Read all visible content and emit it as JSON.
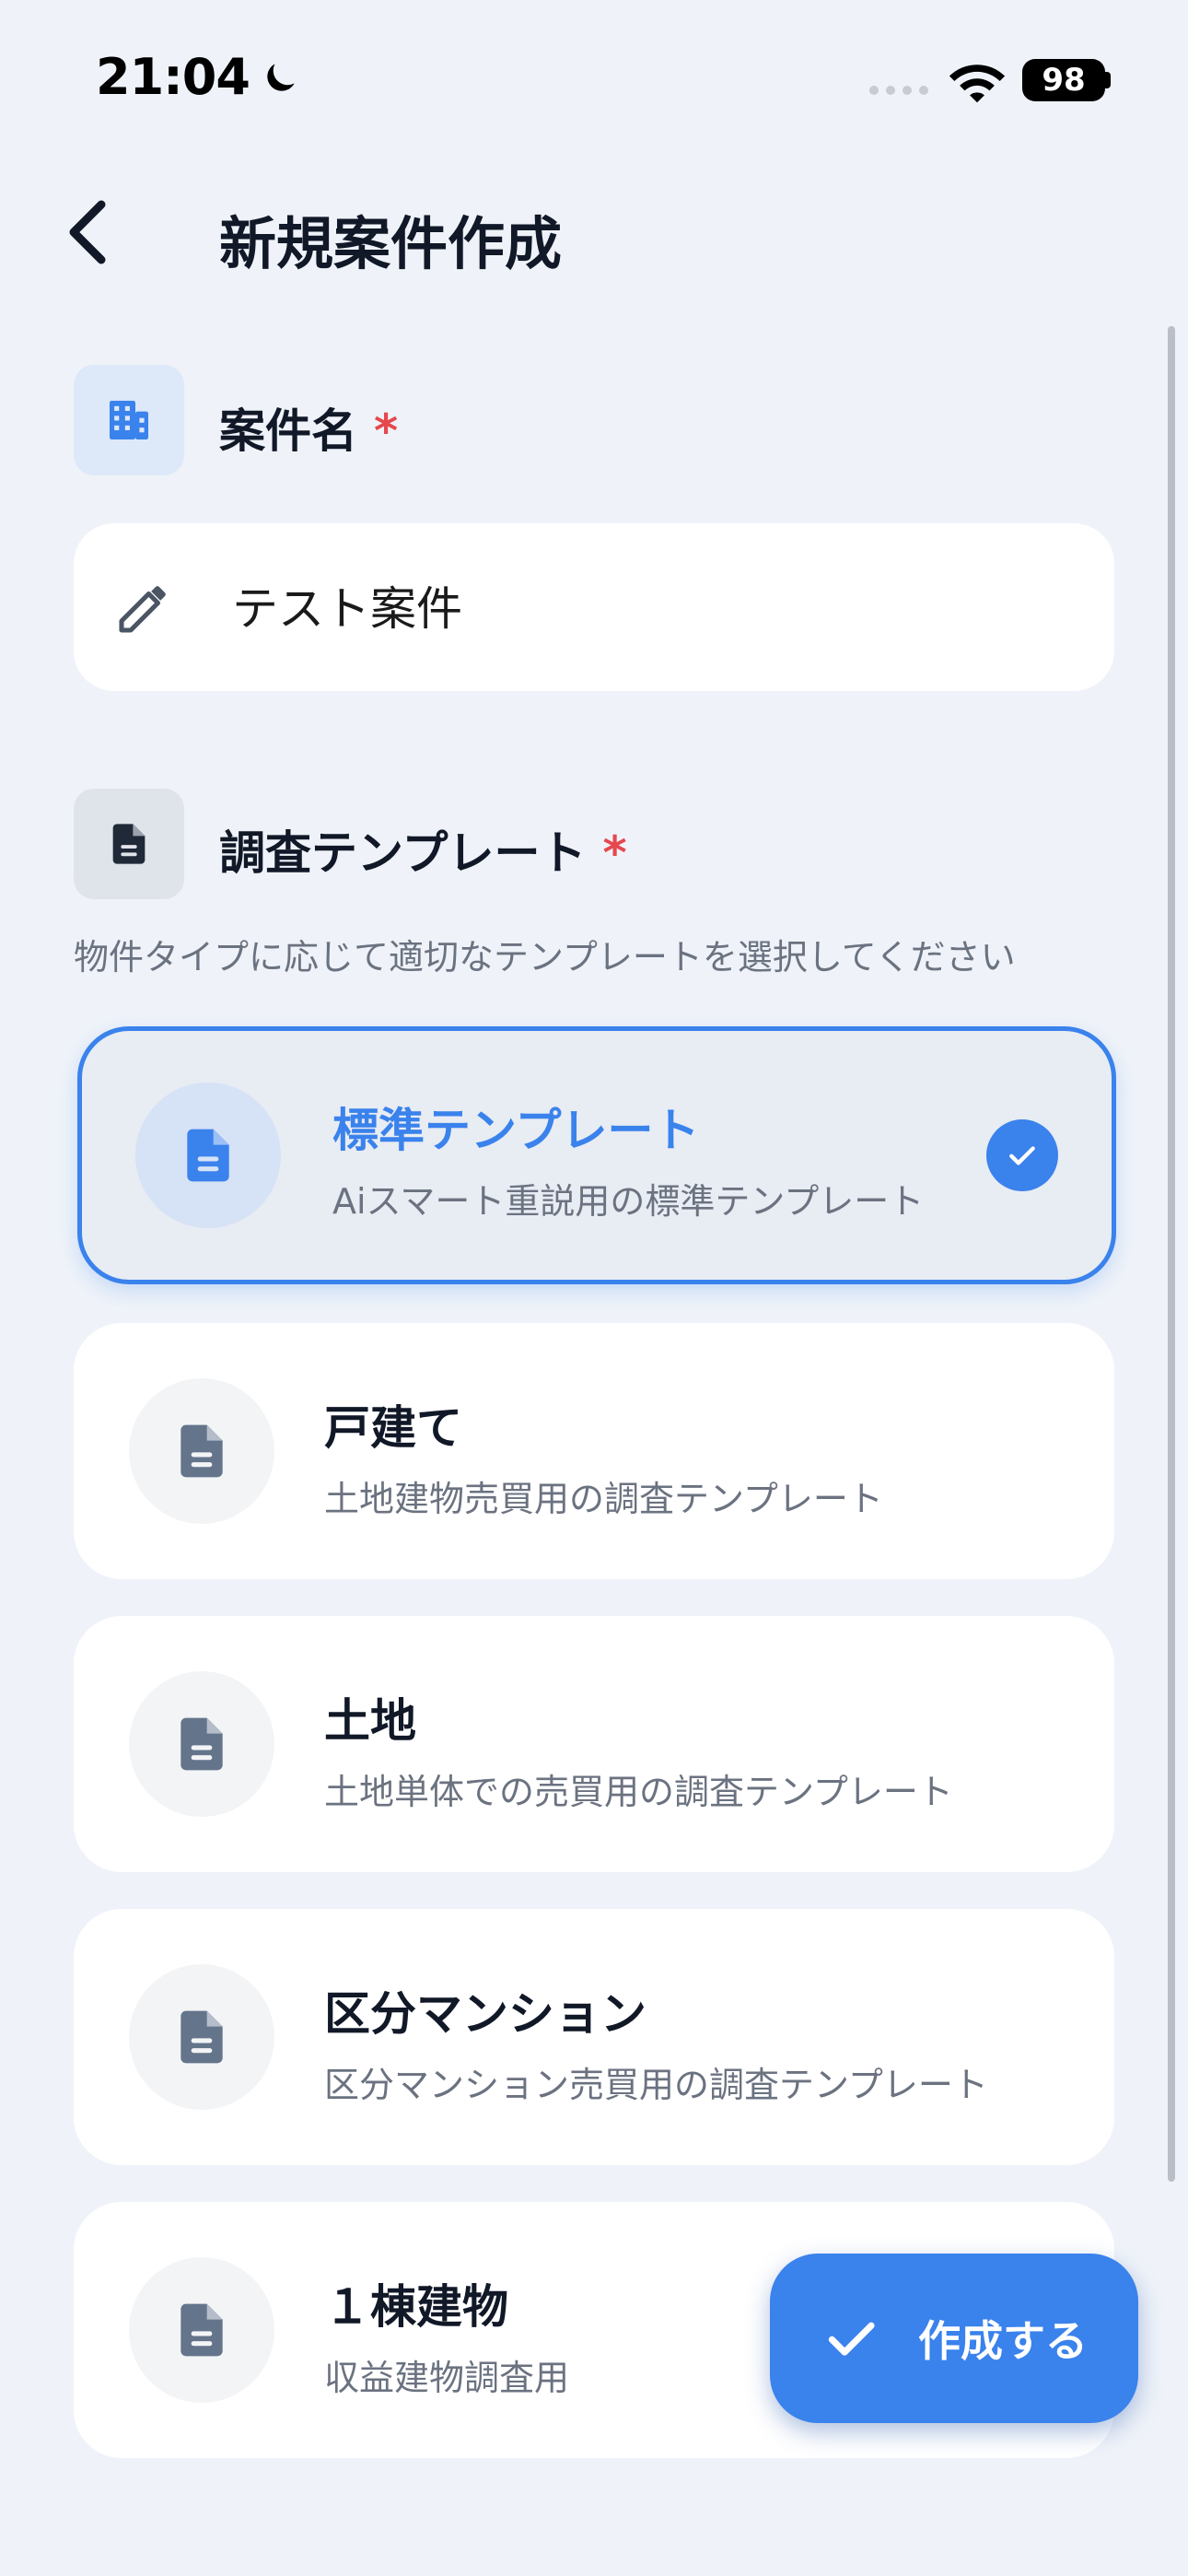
{
  "status_bar": {
    "time": "21:04",
    "battery": "98"
  },
  "header": {
    "title": "新規案件作成"
  },
  "project_name": {
    "label": "案件名",
    "required_mark": "*",
    "value": "テスト案件"
  },
  "template_section": {
    "label": "調査テンプレート",
    "required_mark": "*",
    "hint": "物件タイプに応じて適切なテンプレートを選択してください"
  },
  "templates": [
    {
      "title": "標準テンプレート",
      "subtitle": "Aiスマート重説用の標準テンプレート",
      "selected": true
    },
    {
      "title": "戸建て",
      "subtitle": "土地建物売買用の調査テンプレート",
      "selected": false
    },
    {
      "title": "土地",
      "subtitle": "土地単体での売買用の調査テンプレート",
      "selected": false
    },
    {
      "title": "区分マンション",
      "subtitle": "区分マンション売買用の調査テンプレート",
      "selected": false
    },
    {
      "title": "１棟建物",
      "subtitle": "収益建物調査用",
      "selected": false
    }
  ],
  "fab": {
    "label": "作成する"
  },
  "colors": {
    "accent": "#3a82ec",
    "background": "#eff3f9",
    "required": "#e5484d",
    "icon_gray": "#64748b"
  }
}
